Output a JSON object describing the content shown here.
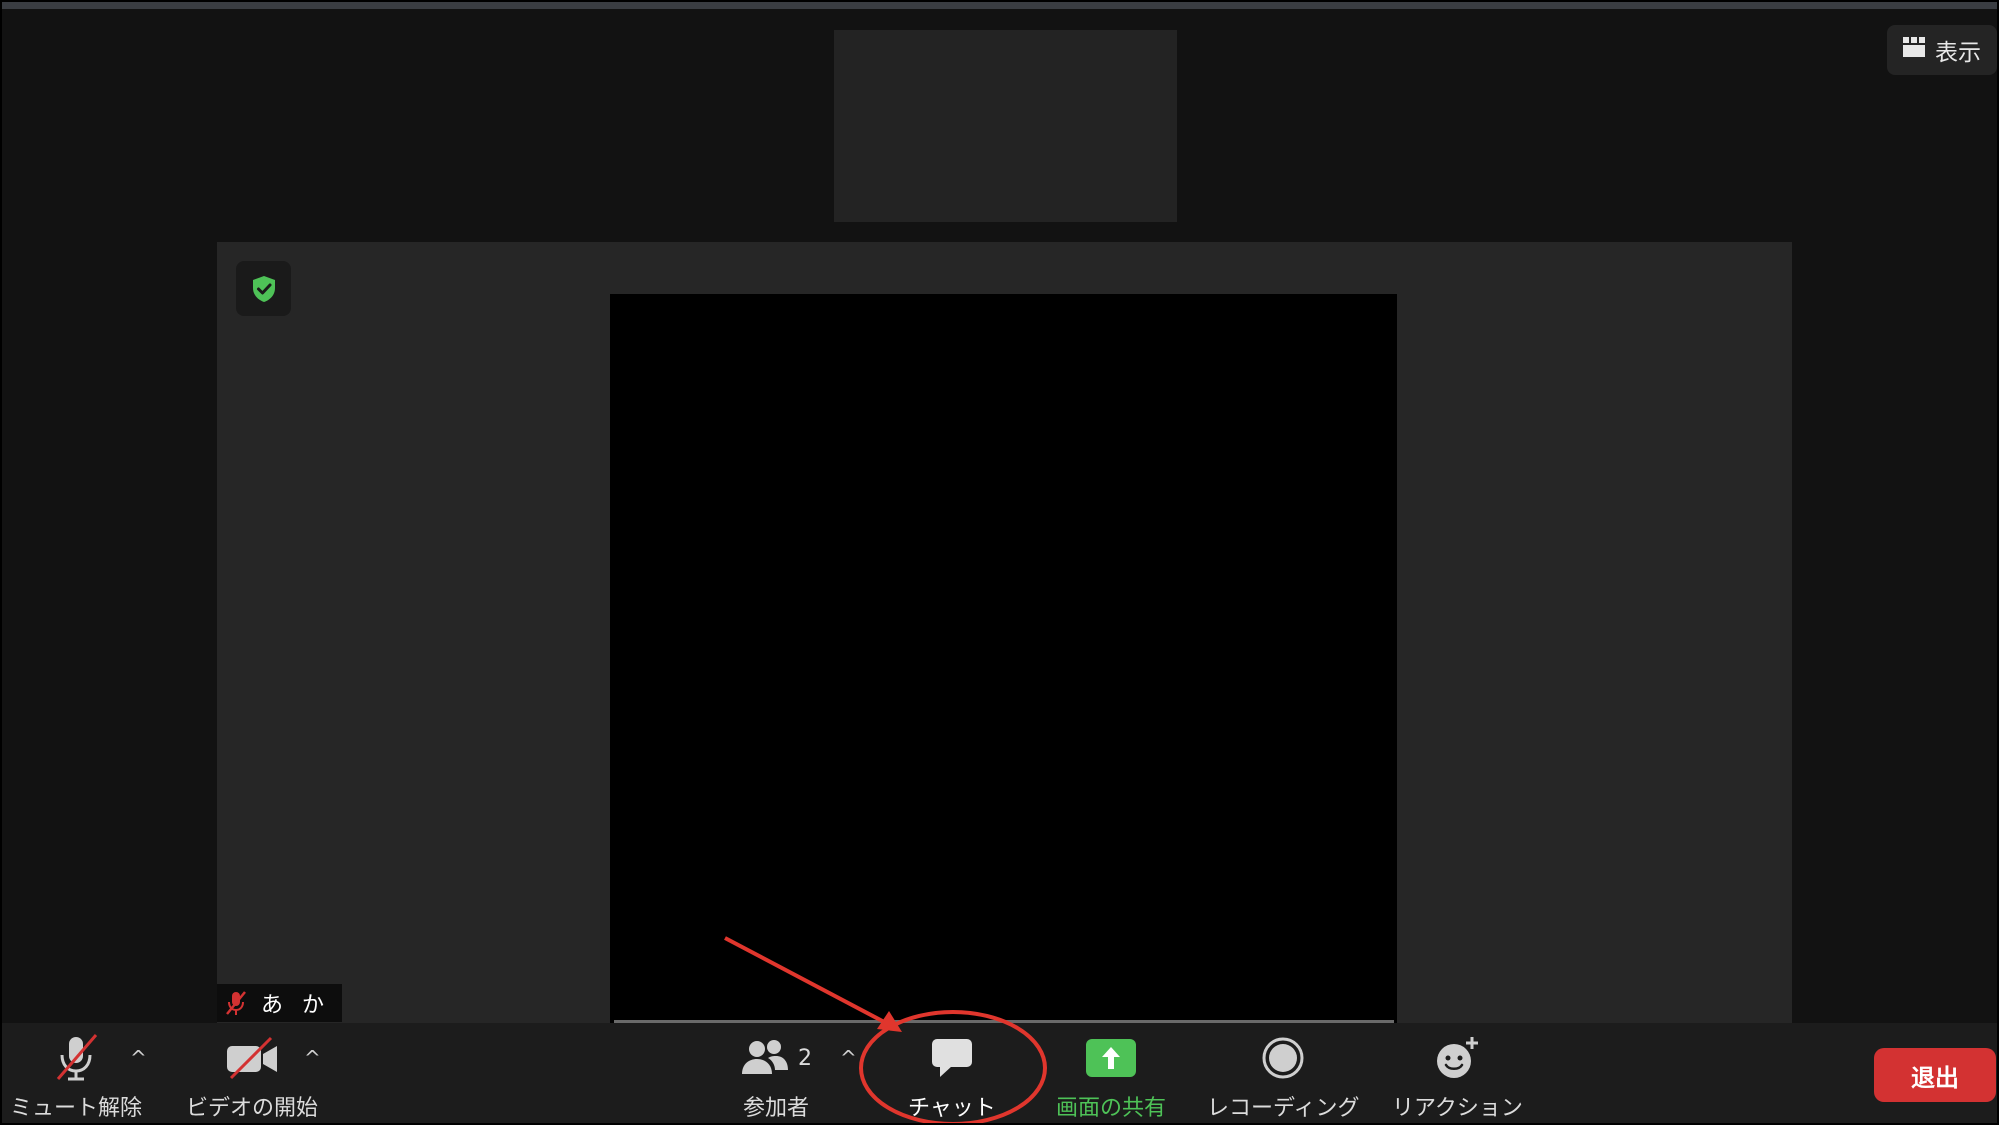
{
  "header": {
    "view_label": "表示"
  },
  "participant": {
    "name": "あ か"
  },
  "toolbar": {
    "unmute_label": "ミュート解除",
    "start_video_label": "ビデオの開始",
    "participants_label": "参加者",
    "participants_count": "2",
    "chat_label": "チャット",
    "share_screen_label": "画面の共有",
    "recording_label": "レコーディング",
    "reactions_label": "リアクション",
    "leave_label": "退出",
    "caret": "^"
  },
  "colors": {
    "share_green": "#4ec257",
    "leave_red": "#d33232",
    "annotation_red": "#e0362d"
  },
  "icons": [
    "grid-icon",
    "shield-check-icon",
    "muted-mic-icon",
    "video-off-icon",
    "participants-icon",
    "chat-icon",
    "share-screen-icon",
    "record-icon",
    "reaction-icon"
  ]
}
